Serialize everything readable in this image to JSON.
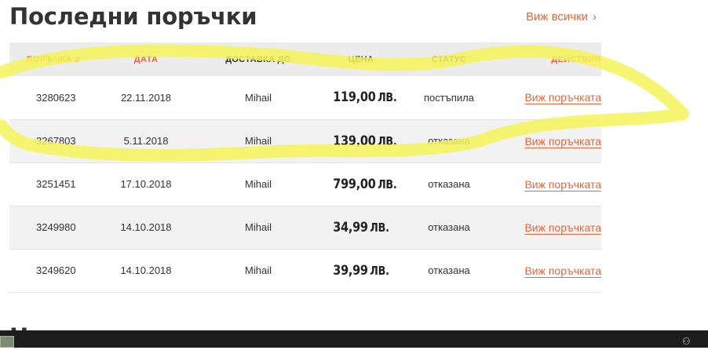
{
  "section_title": "Последни поръчки",
  "view_all_label": "Виж всички",
  "view_all_chevron": "›",
  "table": {
    "headers": [
      "ПОРЪЧКА #",
      "ДАТА",
      "ДОСТАВКА ДО",
      "ЦЕНА",
      "СТАТУС",
      "ДЕЙСТВИЯ"
    ],
    "rows": [
      {
        "order": "3280623",
        "date": "22.11.2018",
        "ship_to": "Mihail",
        "price": "119,00",
        "currency": "ЛВ.",
        "status": "постъпила",
        "action": "Виж поръчката"
      },
      {
        "order": "3267803",
        "date": "5.11.2018",
        "ship_to": "Mihail",
        "price": "139,00",
        "currency": "ЛВ.",
        "status": "отказана",
        "action": "Виж поръчката"
      },
      {
        "order": "3251451",
        "date": "17.10.2018",
        "ship_to": "Mihail",
        "price": "799,00",
        "currency": "ЛВ.",
        "status": "отказана",
        "action": "Виж поръчката"
      },
      {
        "order": "3249980",
        "date": "14.10.2018",
        "ship_to": "Mihail",
        "price": "34,99",
        "currency": "ЛВ.",
        "status": "отказана",
        "action": "Виж поръчката"
      },
      {
        "order": "3249620",
        "date": "14.10.2018",
        "ship_to": "Mihail",
        "price": "39,99",
        "currency": "ЛВ.",
        "status": "отказана",
        "action": "Виж поръчката"
      }
    ]
  },
  "next_section_title_partial": "Н",
  "colors": {
    "accent": "#e4673f",
    "highlight_marker": "#f5f55a",
    "header_bg": "#ececec",
    "alt_row_bg": "#f2f2f2",
    "taskbar_bg": "#1d1d1d"
  },
  "icons": {
    "view_all_chevron": "chevron-right-icon",
    "taskbar_tray": "people-icon"
  }
}
